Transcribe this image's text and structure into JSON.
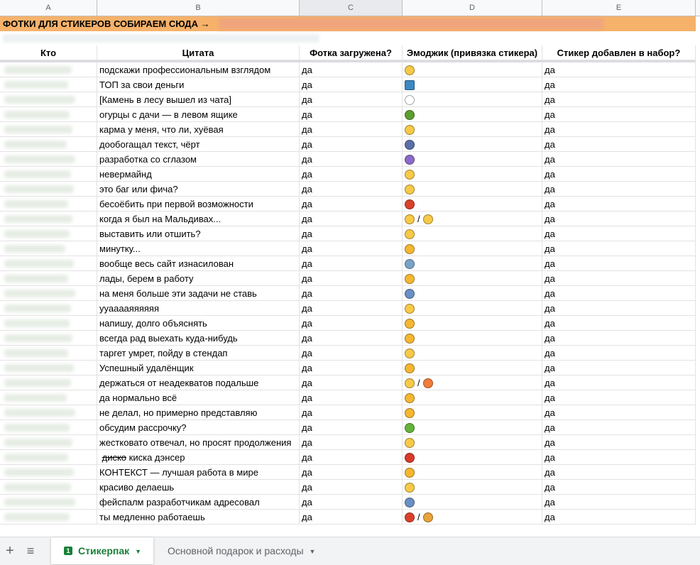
{
  "columns": [
    "A",
    "B",
    "C",
    "D",
    "E"
  ],
  "banner": {
    "text": "ФОТКИ ДЛЯ СТИКЕРОВ СОБИРАЕМ СЮДА →",
    "color": "#f6b26b"
  },
  "headers": {
    "who": "Кто",
    "quote": "Цитата",
    "photo": "Фотка загружена?",
    "emoji": "Эмоджик (привязка стикера)",
    "added": "Стикер добавлен в набор?"
  },
  "rows": [
    {
      "quote": "подскажи профессиональным взглядом",
      "photo": "да",
      "emoji": [
        "nerd-face"
      ],
      "added": "да"
    },
    {
      "quote": "ТОП за свои деньги",
      "photo": "да",
      "emoji": [
        "top-arrow"
      ],
      "added": "да"
    },
    {
      "quote": "[Камень в лесу вышел из чата]",
      "photo": "да",
      "emoji": [
        "eyes"
      ],
      "added": "да"
    },
    {
      "quote": "огурцы с дачи — в левом ящике",
      "photo": "да",
      "emoji": [
        "cucumber"
      ],
      "added": "да"
    },
    {
      "quote": "карма у меня, что ли, хуёвая",
      "photo": "да",
      "emoji": [
        "worried-face"
      ],
      "added": "да"
    },
    {
      "quote": "дообогащал текст, чёрт",
      "photo": "да",
      "emoji": [
        "scientist"
      ],
      "added": "да"
    },
    {
      "quote": "разработка со сглазом",
      "photo": "да",
      "emoji": [
        "crystal-ball"
      ],
      "added": "да"
    },
    {
      "quote": "невермайнд",
      "photo": "да",
      "emoji": [
        "wink-face"
      ],
      "added": "да"
    },
    {
      "quote": "это баг или фича?",
      "photo": "да",
      "emoji": [
        "hushed-face"
      ],
      "added": "да"
    },
    {
      "quote": "бесоёбить при первой возможности",
      "photo": "да",
      "emoji": [
        "devil-face"
      ],
      "added": "да"
    },
    {
      "quote": "когда я был на Мальдивах...",
      "photo": "да",
      "emoji": [
        "sunglasses-face",
        "monocle-face"
      ],
      "added": "да"
    },
    {
      "quote": "выставить или отшить?",
      "photo": "да",
      "emoji": [
        "confused-face"
      ],
      "added": "да"
    },
    {
      "quote": "минутку...",
      "photo": "да",
      "emoji": [
        "index-up"
      ],
      "added": "да"
    },
    {
      "quote": "вообще весь сайт изнасилован",
      "photo": "да",
      "emoji": [
        "fearful-face"
      ],
      "added": "да"
    },
    {
      "quote": "лады, берем в работу",
      "photo": "да",
      "emoji": [
        "thumbs-up"
      ],
      "added": "да"
    },
    {
      "quote": "на меня больше эти задачи не ставь",
      "photo": "да",
      "emoji": [
        "person-tipping"
      ],
      "added": "да"
    },
    {
      "quote": "ууааааяяяяяя",
      "photo": "да",
      "emoji": [
        "zany-face"
      ],
      "added": "да"
    },
    {
      "quote": "напишу, долго объяснять",
      "photo": "да",
      "emoji": [
        "writing-hand"
      ],
      "added": "да"
    },
    {
      "quote": "всегда рад выехать куда-нибудь",
      "photo": "да",
      "emoji": [
        "waving-hand"
      ],
      "added": "да"
    },
    {
      "quote": "таргет умрет, пойду в стендап",
      "photo": "да",
      "emoji": [
        "sweat-smile"
      ],
      "added": "да"
    },
    {
      "quote": "Успешный удалёнщик",
      "photo": "да",
      "emoji": [
        "victory-hand"
      ],
      "added": "да"
    },
    {
      "quote": "держаться от неадекватов подальше",
      "photo": "да",
      "emoji": [
        "frowning-face",
        "tongue-face"
      ],
      "added": "да"
    },
    {
      "quote": "да нормально всё",
      "photo": "да",
      "emoji": [
        "ok-hand"
      ],
      "added": "да"
    },
    {
      "quote": "не делал, но примерно представляю",
      "photo": "да",
      "emoji": [
        "raised-hands"
      ],
      "added": "да"
    },
    {
      "quote": "обсудим рассрочку?",
      "photo": "да",
      "emoji": [
        "money-face"
      ],
      "added": "да"
    },
    {
      "quote": "жестковато отвечал, но просят продолжения",
      "photo": "да",
      "emoji": [
        "smirk-face"
      ],
      "added": "да"
    },
    {
      "quote_strike": "диско",
      "quote": " киска дэнсер",
      "photo": "да",
      "emoji": [
        "dancer"
      ],
      "added": "да"
    },
    {
      "quote": "КОНТЕКСТ — лучшая работа в мире",
      "photo": "да",
      "emoji": [
        "vulcan-hand"
      ],
      "added": "да"
    },
    {
      "quote": "красиво делаешь",
      "photo": "да",
      "emoji": [
        "relieved-face"
      ],
      "added": "да"
    },
    {
      "quote": "фейспалм разработчикам адресовал",
      "photo": "да",
      "emoji": [
        "facepalm"
      ],
      "added": "да"
    },
    {
      "quote": "ты медленно работаешь",
      "photo": "да",
      "emoji": [
        "angry-face",
        "hourglass"
      ],
      "added": "да"
    }
  ],
  "emoji_separator": "/",
  "emoji_colors": {
    "nerd-face": "#f7c948",
    "top-arrow": "#3b88c3",
    "eyes": "#ffffff",
    "cucumber": "#5c9e31",
    "worried-face": "#f7c948",
    "scientist": "#5b6fa8",
    "crystal-ball": "#8e6ac8",
    "wink-face": "#f7c948",
    "hushed-face": "#f7c948",
    "devil-face": "#d9412b",
    "sunglasses-face": "#f7c948",
    "monocle-face": "#f7c948",
    "confused-face": "#f7c948",
    "index-up": "#f5b731",
    "fearful-face": "#7aa3c9",
    "thumbs-up": "#f5b731",
    "person-tipping": "#6a8fc5",
    "zany-face": "#f7c948",
    "writing-hand": "#f5b731",
    "waving-hand": "#f5b731",
    "sweat-smile": "#f7c948",
    "victory-hand": "#f5b731",
    "frowning-face": "#f7c948",
    "tongue-face": "#f27b3a",
    "ok-hand": "#f5b731",
    "raised-hands": "#f5b731",
    "money-face": "#65b33a",
    "smirk-face": "#f7c948",
    "dancer": "#d93a2b",
    "vulcan-hand": "#f5b731",
    "relieved-face": "#f7c948",
    "facepalm": "#6a8fc5",
    "angry-face": "#d9412b",
    "hourglass": "#e8a33b"
  },
  "tabs": {
    "add_icon": "+",
    "menu_icon": "≡",
    "active": "Стикерпак",
    "inactive": "Основной подарок и расходы",
    "caret": "▼"
  }
}
